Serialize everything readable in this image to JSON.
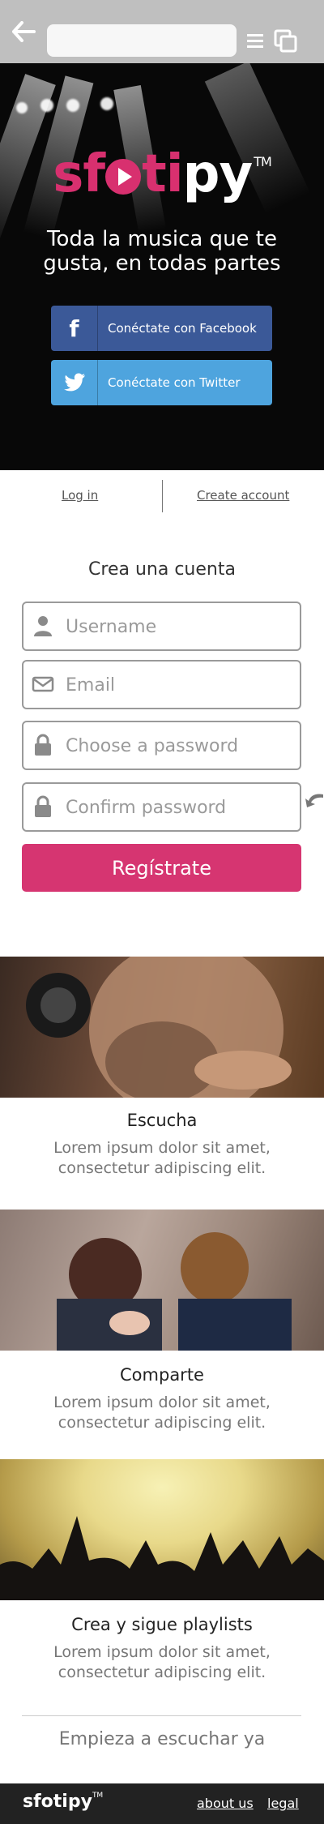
{
  "hero": {
    "logo_pre": "sf",
    "logo_post": "tipy",
    "logo_tm": "TM",
    "tagline": "Toda la musica que te gusta, en todas partes",
    "facebook_label": "Conéctate con Facebook",
    "twitter_label": "Conéctate con Twitter"
  },
  "auth": {
    "login_label": "Log in",
    "create_label": "Create account"
  },
  "form": {
    "title": "Crea una cuenta",
    "username_placeholder": "Username",
    "email_placeholder": "Email",
    "password_placeholder": "Choose a password",
    "confirm_placeholder": "Confirm password",
    "submit_label": "Regístrate"
  },
  "features": [
    {
      "title": "Escucha",
      "text": "Lorem ipsum dolor sit amet, consectetur adipiscing elit."
    },
    {
      "title": "Comparte",
      "text": "Lorem ipsum dolor sit amet, consectetur adipiscing elit."
    },
    {
      "title": "Crea y sigue playlists",
      "text": "Lorem ipsum dolor sit amet, consectetur adipiscing elit."
    }
  ],
  "cta": "Empieza a escuchar ya",
  "footer": {
    "logo": "sfotipy",
    "logo_tm": "TM",
    "about_label": "about us",
    "legal_label": "legal"
  },
  "colors": {
    "brand_pink": "#d63571",
    "facebook": "#3b5998",
    "twitter": "#4ea4de",
    "footer_bg": "#222222"
  },
  "icons": [
    "back-arrow-icon",
    "menu-icon",
    "tabs-icon",
    "facebook-icon",
    "twitter-icon",
    "user-icon",
    "envelope-icon",
    "lock-icon",
    "pointer-arrow-icon"
  ]
}
